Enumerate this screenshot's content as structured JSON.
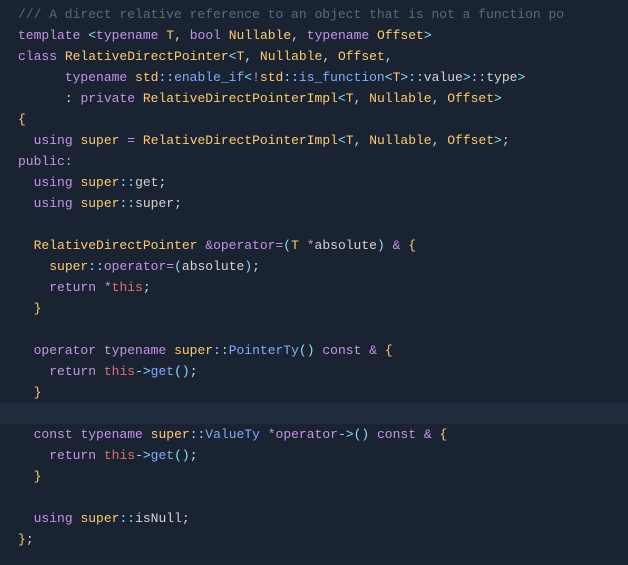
{
  "tokens": {
    "template": "template",
    "typename": "typename",
    "bool": "bool",
    "class": "class",
    "using": "using",
    "private": "private",
    "public": "public:",
    "return": "return",
    "const": "const",
    "operator": "operator",
    "this": "this",
    "T": "T",
    "Nullable": "Nullable",
    "Offset": "Offset",
    "RelativeDirectPointer": "RelativeDirectPointer",
    "RelativeDirectPointerImpl": "RelativeDirectPointerImpl",
    "std": "std",
    "enable_if": "enable_if",
    "is_function": "is_function",
    "value": "value",
    "type": "type",
    "super": "super",
    "get": "get",
    "absolute": "absolute",
    "PointerTy": "PointerTy",
    "ValueTy": "ValueTy",
    "isNull": "isNull",
    "lt": "<",
    "gt": ">",
    "comma": ",",
    "space": " ",
    "scope": "::",
    "neg": "!",
    "amp": "&",
    "eq": "=",
    "lbrace": "{",
    "rbrace": "}",
    "lparen": "(",
    "rparen": ")",
    "star": "*",
    "semi": ";",
    "colon": ":",
    "arrow": "->",
    "comment_top": "/// A direct relative reference to an object that is not a function po",
    "i2": "  ",
    "i4": "    ",
    "i6": "      ",
    "i8": "        "
  }
}
